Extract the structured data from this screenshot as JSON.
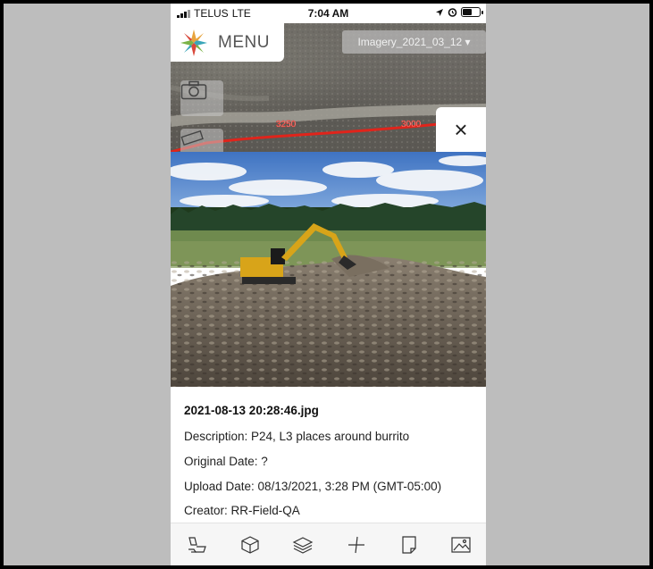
{
  "status_bar": {
    "carrier": "TELUS",
    "network": "LTE",
    "time": "7:04 AM"
  },
  "header": {
    "menu_label": "MENU",
    "imagery_select": "Imagery_2021_03_12 ▾"
  },
  "map": {
    "chainage_labels": [
      "3250",
      "3000"
    ],
    "route_color": "#e0241b"
  },
  "photo_details": {
    "filename": "2021-08-13 20:28:46.jpg",
    "description": "Description: P24, L3 places around burrito",
    "original_date": "Original Date: ?",
    "upload_date": "Upload Date: 08/13/2021, 3:28 PM (GMT-05:00)",
    "creator": "Creator: RR-Field-QA"
  },
  "close_label": "×",
  "toolbar": {
    "items": [
      {
        "icon": "site-plan-icon"
      },
      {
        "icon": "3d-box-icon"
      },
      {
        "icon": "layers-icon"
      },
      {
        "icon": "measure-cross-icon"
      },
      {
        "icon": "document-icon"
      },
      {
        "icon": "image-gallery-icon"
      }
    ]
  },
  "colors": {
    "frame_bg": "#bdbdbd",
    "logo_colors": [
      "#e8a33c",
      "#3aa6b9",
      "#d9483b",
      "#7bb347"
    ]
  }
}
